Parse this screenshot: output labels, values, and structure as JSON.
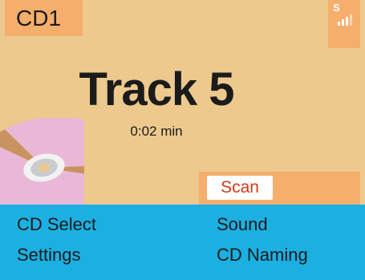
{
  "header": {
    "source_label": "CD1",
    "signal_letter": "S",
    "signal_icon": "signal-strength-icon"
  },
  "track": {
    "title": "Track 5",
    "elapsed": "0:02 min"
  },
  "disc": {
    "icon": "cd-disc-icon"
  },
  "scan": {
    "label": "Scan"
  },
  "menu": {
    "items": [
      {
        "label": "CD Select"
      },
      {
        "label": "Settings"
      },
      {
        "label": "Sound"
      },
      {
        "label": "CD Naming"
      }
    ]
  },
  "colors": {
    "main_background": "#edc98d",
    "accent_orange": "#f6ae6c",
    "menu_background": "#1cb0e2",
    "scan_text": "#d4371c",
    "text": "#1b1b1b"
  }
}
